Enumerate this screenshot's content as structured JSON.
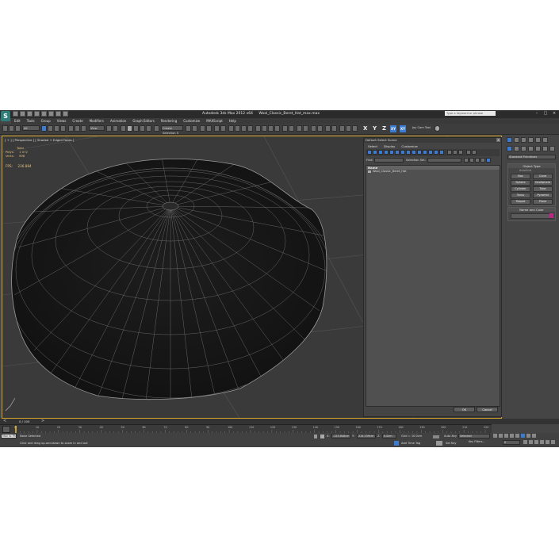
{
  "title": {
    "app": "Autodesk 3ds Max  2012 x64",
    "file": "Wool_Classic_Beret_Hat_max.max",
    "search_placeholder": "Type a keyword or phrase"
  },
  "menu": [
    "Edit",
    "Tools",
    "Group",
    "Views",
    "Create",
    "Modifiers",
    "Animation",
    "Graph Editors",
    "Rendering",
    "Customize",
    "MAXScript",
    "Help"
  ],
  "toolbar": {
    "selection_filter": "All",
    "coord_system": "View",
    "named_selection": "Create Selection S",
    "axes": [
      "X",
      "Y",
      "Z",
      "XY",
      "XY"
    ],
    "joy_label": "Joy Cam Tool"
  },
  "viewport": {
    "label": "[ + ] [ Perspective ] [ Shaded + Edged Faces ]",
    "stats": {
      "total_label": "Total",
      "polys_label": "Polys:",
      "polys_value": "1 072",
      "verts_label": "Verts:",
      "verts_value": "998",
      "fps_label": "FPS:",
      "fps_value": "236.884"
    }
  },
  "scene_dialog": {
    "title": "Default Select Scene",
    "close": "×",
    "menu": [
      "Select",
      "Display",
      "Customize"
    ],
    "find_label": "Find:",
    "selection_set_label": "Selection Set:",
    "column_header": "Name",
    "items": [
      "Wool_Classic_Beret_Hat"
    ],
    "ok_label": "OK",
    "cancel_label": "Cancel"
  },
  "command_panel": {
    "category": "Standard Primitives",
    "object_type_title": "Object Type",
    "autogrid": "AutoGrid",
    "primitives": [
      "Box",
      "Cone",
      "Sphere",
      "GeoSphere",
      "Cylinder",
      "Tube",
      "Torus",
      "Pyramid",
      "Teapot",
      "Plane"
    ],
    "name_color_title": "Name and Color",
    "swatch_color": "#c0238a"
  },
  "time_slider": {
    "label": "0 / 100"
  },
  "trackbar": {
    "ticks": [
      "0",
      "10",
      "20",
      "30",
      "40",
      "50",
      "60",
      "70",
      "80",
      "90",
      "100",
      "110",
      "120",
      "130",
      "140",
      "150",
      "160",
      "170",
      "180",
      "190",
      "200",
      "210",
      "220"
    ]
  },
  "status": {
    "maxscript": "Max to Ph",
    "selection": "None Selected",
    "prompt": "Click and drag up-and-down to zoom in and out",
    "x_label": "X:",
    "x_value": "-123.848cm",
    "y_label": "Y:",
    "y_value": "214.159cm",
    "z_label": "Z:",
    "z_value": "0.0cm",
    "grid": "Grid = 10.0cm",
    "auto_key": "Auto Key",
    "selected": "Selected",
    "set_key": "Set Key",
    "key_filters": "Key Filters...",
    "add_time_tag": "Add Time Tag",
    "frame": "0"
  },
  "colors": {
    "accent": "#3d7bd0",
    "viewport_border": "#d4a52a",
    "stats_text": "#e6c07b"
  }
}
